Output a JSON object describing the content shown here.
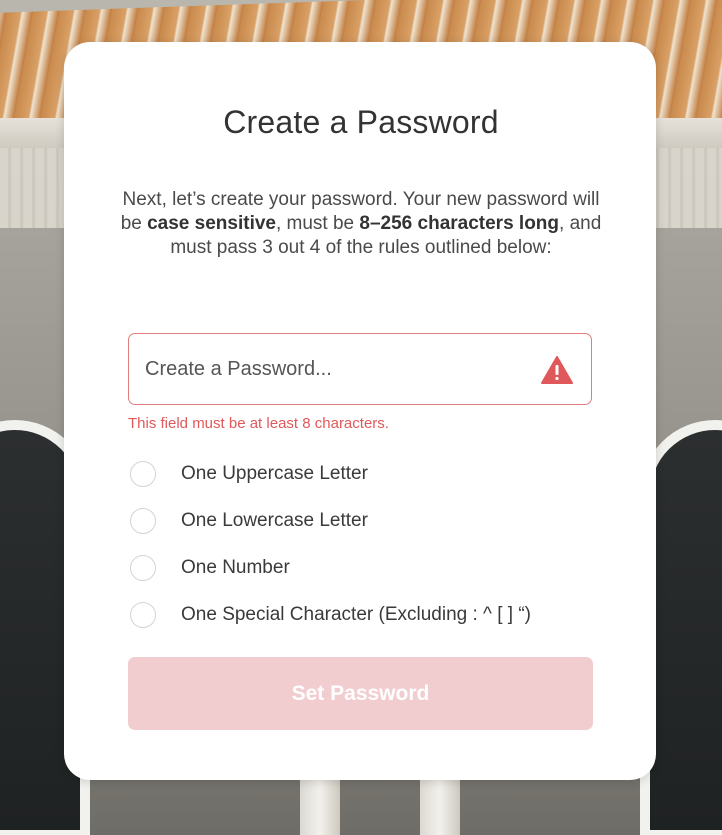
{
  "card": {
    "title": "Create a Password",
    "intro": {
      "part1": "Next, let’s create your password. Your new password will be ",
      "case_sensitive": "case sensitive",
      "part2": ", must be ",
      "length_rule": "8–256 characters long",
      "part3": ", and must pass 3 out 4 of the rules outlined below:"
    }
  },
  "password_field": {
    "placeholder": "Create a Password...",
    "value": "",
    "error": "This field must be at least 8 characters.",
    "icon": "warning-triangle-icon"
  },
  "rules": [
    {
      "label": "One Uppercase Letter",
      "checked": false
    },
    {
      "label": "One Lowercase Letter",
      "checked": false
    },
    {
      "label": "One Number",
      "checked": false
    },
    {
      "label": "One Special Character (Excluding : ^ [ ] “)",
      "checked": false
    }
  ],
  "submit": {
    "label": "Set Password",
    "disabled": true
  },
  "colors": {
    "error": "#e0595a",
    "button_disabled": "#f2cdd0"
  }
}
